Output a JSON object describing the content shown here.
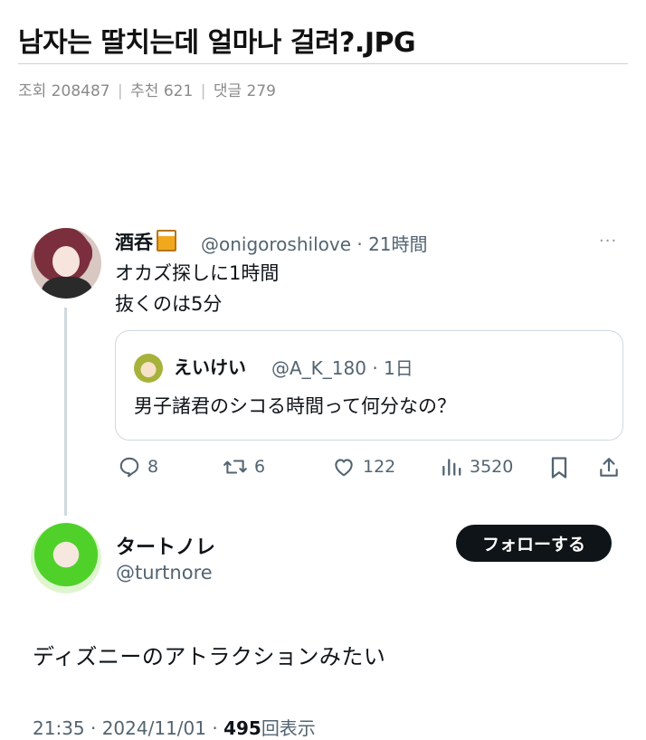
{
  "post": {
    "title": "남자는 딸치는데 얼마나 걸려?.JPG",
    "views_label": "조회 208487",
    "recommend_label": "추천 621",
    "comments_label": "댓글 279",
    "separator": "|"
  },
  "tweet": {
    "author_name": "酒呑",
    "author_handle": "@onigoroshilove · 21時間",
    "more_label": "···",
    "text_line1": "オカズ探しに1時間",
    "text_line2": "抜くのは5分",
    "quote": {
      "author_name": "えいけい",
      "author_handle": "@A_K_180 · 1日",
      "text": "男子諸君のシコる時間って何分なの？"
    },
    "actions": {
      "replies": "8",
      "retweets": "6",
      "likes": "122",
      "views": "3520"
    }
  },
  "reply": {
    "author_name": "タートノレ",
    "author_handle": "@turtnore",
    "follow_label": "フォローする",
    "text": "ディズニーのアトラクションみたい",
    "time": "21:35 · 2024/11/01 · ",
    "views_count": "495",
    "views_suffix": "回表示"
  },
  "colors": {
    "text": "#0f1419",
    "secondary": "#536471",
    "border": "#cfd9de",
    "follow_bg": "#0f1419"
  },
  "icons": [
    "reply-icon",
    "retweet-icon",
    "like-icon",
    "views-icon",
    "bookmark-icon",
    "share-icon",
    "more-icon",
    "beer-icon"
  ]
}
